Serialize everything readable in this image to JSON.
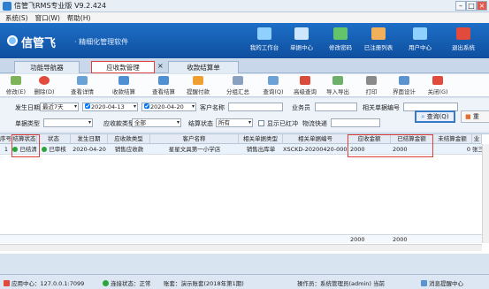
{
  "window": {
    "title": "信管飞RMS专业版 V9.2.424"
  },
  "menu": [
    "系统(S)",
    "窗口(W)",
    "帮助(H)"
  ],
  "banner": {
    "logo": "信管飞",
    "tagline": "· 精细化管理软件",
    "nav": [
      "我的工作台",
      "单据中心",
      "修改密码",
      "已注册列表",
      "用户中心",
      "退出系统"
    ]
  },
  "tabs": [
    "功能导航器",
    "应收款管理",
    "收款结算单"
  ],
  "toolbar": [
    "修改(E)",
    "删除(D)",
    "查看详情",
    "收款结算",
    "查看结算",
    "提醒付款",
    "分组汇总",
    "查询(Q)",
    "高级查询",
    "导入导出",
    "打印",
    "界面设计",
    "关闭(G)"
  ],
  "filters": {
    "date_label": "发生日期",
    "date_range": "最近7天",
    "date_from": "2020-04-13",
    "date_to": "2020-04-20",
    "customer_label": "客户名称",
    "clerk_label": "业务员",
    "docno_label": "相关单据编号",
    "doctype_label": "单据类型",
    "artype_label": "应收款类型",
    "artype_value": "全部",
    "settle_label": "结算状态",
    "settle_value": "所有",
    "redflag_label": "显示已红冲",
    "logistics_label": "物流快递",
    "query_button": "查询(Q)",
    "reset_button": "重"
  },
  "grid": {
    "headers": [
      "序号",
      "结算状态",
      "状态",
      "发生日期",
      "应收款类型",
      "客户名称",
      "相关单据类型",
      "相关单据编号",
      "应收金额",
      "已结算金额",
      "未结算金额",
      "业"
    ],
    "rows": [
      [
        "1",
        "已结清",
        "已审核",
        "2020-04-20",
        "销售应收款",
        "星星文具第一小学店",
        "销售出库单",
        "XSCKD-20200420-0001",
        "2000",
        "2000",
        "0",
        "张三"
      ]
    ],
    "totals": {
      "amount": "2000",
      "settled": "2000"
    }
  },
  "status": {
    "center": "应用中心：127.0.0.1:7099",
    "connection": "连接状态：正常",
    "account": "账套：演示账套(2018年第1期)",
    "operator": "操作员：系统管理员(admin) 当前",
    "messages": "消息提醒中心"
  }
}
